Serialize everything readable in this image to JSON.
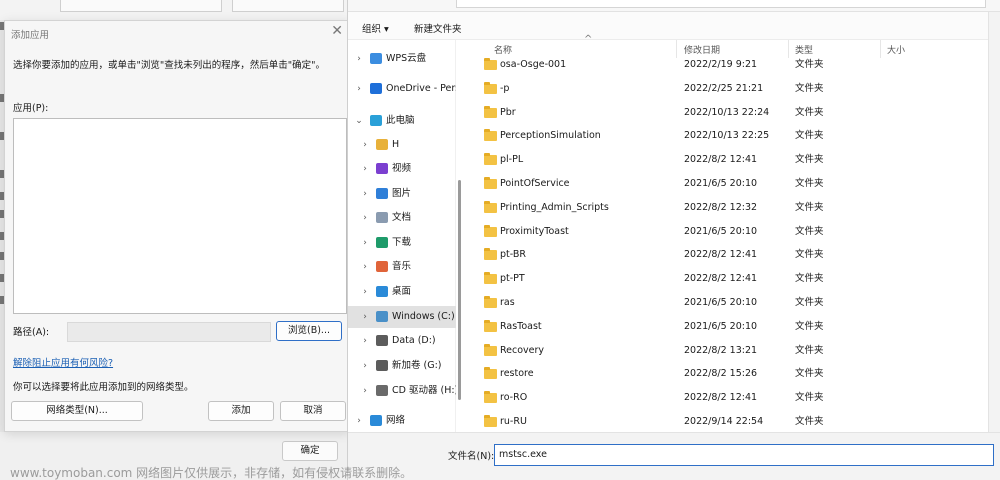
{
  "add_app_dialog": {
    "title": "添加应用",
    "close_glyph": "✕",
    "instruction": "选择你要添加的应用，或单击\"浏览\"查找未列出的程序，然后单击\"确定\"。",
    "app_label": "应用(P):",
    "path_label": "路径(A):",
    "path_value": "",
    "browse_button": "浏览(B)...",
    "risk_link": "解除阻止应用有何风险?",
    "network_note": "你可以选择要将此应用添加到的网络类型。",
    "network_type_button": "网络类型(N)...",
    "add_button": "添加",
    "cancel_button": "取消"
  },
  "background": {
    "ok_button": "确定"
  },
  "file_dialog": {
    "toolbar": {
      "organize": "组织",
      "organize_caret": "▾",
      "new_folder": "新建文件夹"
    },
    "nav": [
      {
        "label": "WPS云盘",
        "chevron": "›",
        "icon": "cloud-icon",
        "color": "#3b8de0"
      },
      {
        "label": "OneDrive - Pers",
        "chevron": "›",
        "icon": "onedrive-icon",
        "color": "#1e6fd9"
      },
      {
        "label": "此电脑",
        "chevron": "⌄",
        "icon": "computer-icon",
        "color": "#2aa0d8"
      },
      {
        "label": "H",
        "chevron": "›",
        "icon": "user-folder-icon",
        "color": "#e8b13a"
      },
      {
        "label": "视频",
        "chevron": "›",
        "icon": "video-icon",
        "color": "#7b3fd0"
      },
      {
        "label": "图片",
        "chevron": "›",
        "icon": "picture-icon",
        "color": "#2f7fd8"
      },
      {
        "label": "文档",
        "chevron": "›",
        "icon": "document-icon",
        "color": "#8a9bb0"
      },
      {
        "label": "下载",
        "chevron": "›",
        "icon": "download-icon",
        "color": "#1e9b6a"
      },
      {
        "label": "音乐",
        "chevron": "›",
        "icon": "music-icon",
        "color": "#e0643a"
      },
      {
        "label": "桌面",
        "chevron": "›",
        "icon": "desktop-icon",
        "color": "#2a8ad8"
      },
      {
        "label": "Windows (C:)",
        "chevron": "›",
        "icon": "drive-icon",
        "color": "#4a90c8",
        "selected": true
      },
      {
        "label": "Data (D:)",
        "chevron": "›",
        "icon": "drive-icon",
        "color": "#5c5c5c"
      },
      {
        "label": "新加卷 (G:)",
        "chevron": "›",
        "icon": "drive-icon",
        "color": "#5c5c5c"
      },
      {
        "label": "CD 驱动器 (H:)",
        "chevron": "›",
        "icon": "cd-drive-icon",
        "color": "#6a6a6a"
      },
      {
        "label": "网络",
        "chevron": "›",
        "icon": "network-icon",
        "color": "#2a8ad8"
      }
    ],
    "columns": {
      "name": "名称",
      "date": "修改日期",
      "type": "类型",
      "size": "大小",
      "sort_glyph": "^"
    },
    "files": [
      {
        "name": "osa-Osge-001",
        "date": "2022/2/19 9:21",
        "type": "文件夹"
      },
      {
        "name": "-p",
        "date": "2022/2/25 21:21",
        "type": "文件夹"
      },
      {
        "name": "Pbr",
        "date": "2022/10/13 22:24",
        "type": "文件夹"
      },
      {
        "name": "PerceptionSimulation",
        "date": "2022/10/13 22:25",
        "type": "文件夹"
      },
      {
        "name": "pl-PL",
        "date": "2022/8/2 12:41",
        "type": "文件夹"
      },
      {
        "name": "PointOfService",
        "date": "2021/6/5 20:10",
        "type": "文件夹"
      },
      {
        "name": "Printing_Admin_Scripts",
        "date": "2022/8/2 12:32",
        "type": "文件夹"
      },
      {
        "name": "ProximityToast",
        "date": "2021/6/5 20:10",
        "type": "文件夹"
      },
      {
        "name": "pt-BR",
        "date": "2022/8/2 12:41",
        "type": "文件夹"
      },
      {
        "name": "pt-PT",
        "date": "2022/8/2 12:41",
        "type": "文件夹"
      },
      {
        "name": "ras",
        "date": "2021/6/5 20:10",
        "type": "文件夹"
      },
      {
        "name": "RasToast",
        "date": "2021/6/5 20:10",
        "type": "文件夹"
      },
      {
        "name": "Recovery",
        "date": "2022/8/2 13:21",
        "type": "文件夹"
      },
      {
        "name": "restore",
        "date": "2022/8/2 15:26",
        "type": "文件夹"
      },
      {
        "name": "ro-RO",
        "date": "2022/8/2 12:41",
        "type": "文件夹"
      },
      {
        "name": "ru-RU",
        "date": "2022/9/14 22:54",
        "type": "文件夹"
      }
    ],
    "filename_label": "文件名(N):",
    "filename_value": "mstsc.exe"
  },
  "watermark": "www.toymoban.com 网络图片仅供展示，非存储，如有侵权请联系删除。"
}
